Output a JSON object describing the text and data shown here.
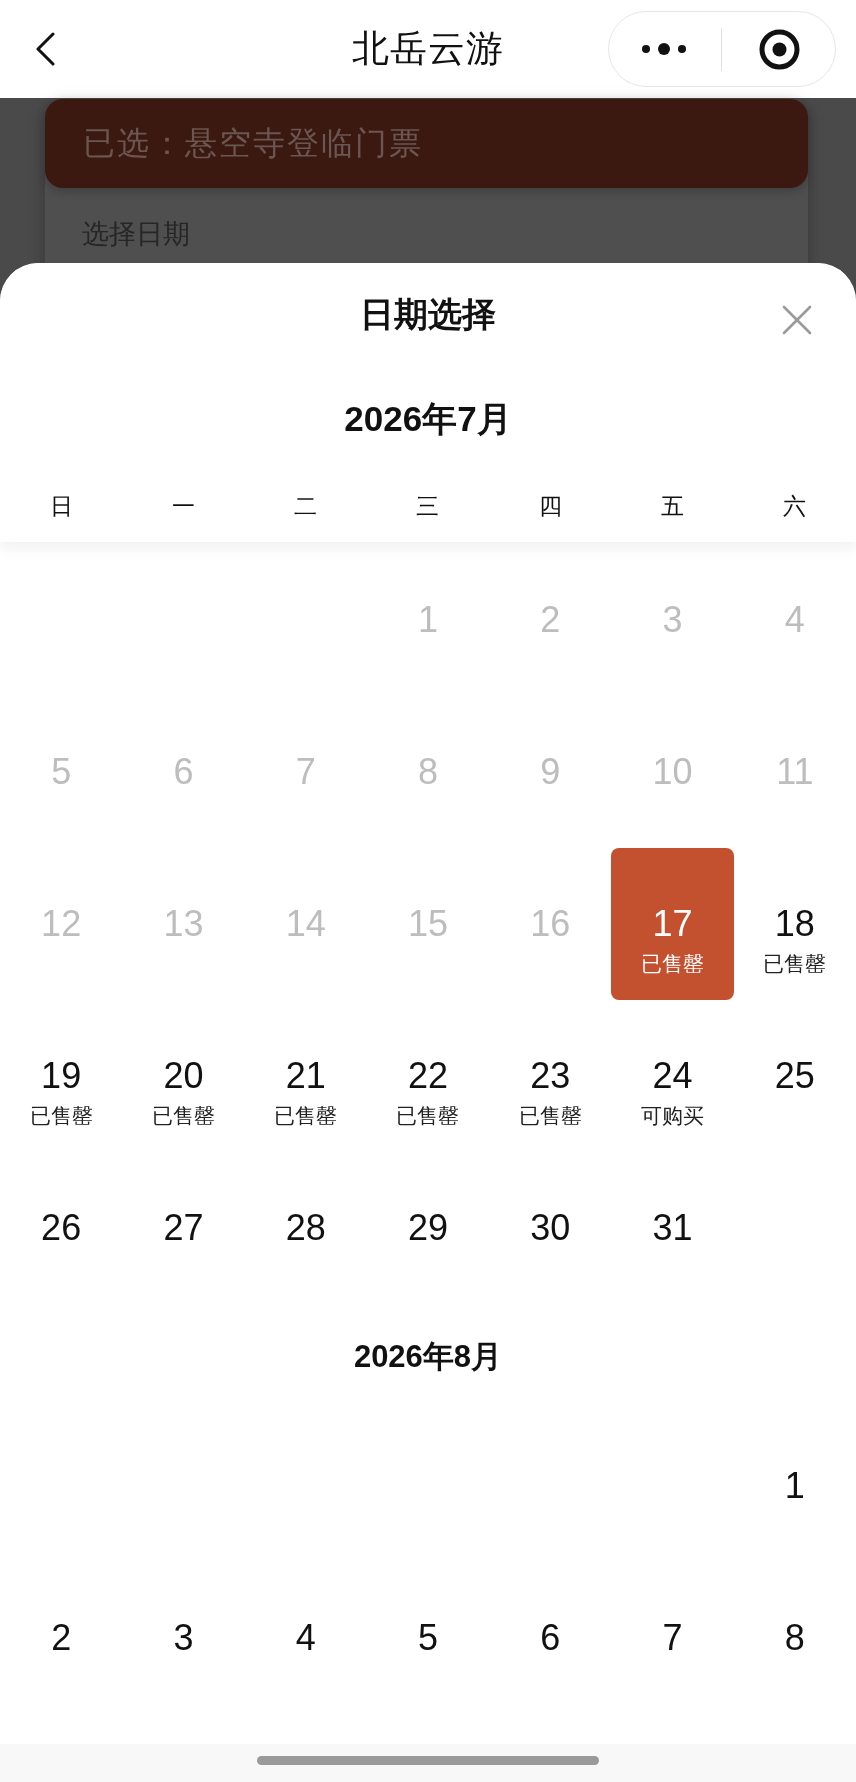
{
  "nav_bar": {
    "title": "北岳云游"
  },
  "background_page": {
    "selected_banner": "已选：悬空寺登临门票",
    "section_label": "选择日期"
  },
  "date_sheet": {
    "title": "日期选择",
    "current_month": "2026年7月",
    "weekdays": [
      "日",
      "一",
      "二",
      "三",
      "四",
      "五",
      "六"
    ],
    "months": [
      {
        "weeks": [
          {
            "right_aligned": true,
            "days": [
              {
                "day": "1",
                "disabled": true,
                "selected": false
              },
              {
                "day": "2",
                "disabled": true,
                "selected": false
              },
              {
                "day": "3",
                "disabled": true,
                "selected": false
              },
              {
                "day": "4",
                "disabled": true,
                "selected": false
              }
            ]
          },
          {
            "days": [
              {
                "day": "5",
                "disabled": true,
                "selected": false
              },
              {
                "day": "6",
                "disabled": true,
                "selected": false
              },
              {
                "day": "7",
                "disabled": true,
                "selected": false
              },
              {
                "day": "8",
                "disabled": true,
                "selected": false
              },
              {
                "day": "9",
                "disabled": true,
                "selected": false
              },
              {
                "day": "10",
                "disabled": true,
                "selected": false
              },
              {
                "day": "11",
                "disabled": true,
                "selected": false
              }
            ]
          },
          {
            "days": [
              {
                "day": "12",
                "disabled": true,
                "selected": false
              },
              {
                "day": "13",
                "disabled": true,
                "selected": false
              },
              {
                "day": "14",
                "disabled": true,
                "selected": false
              },
              {
                "day": "15",
                "disabled": true,
                "selected": false
              },
              {
                "day": "16",
                "disabled": true,
                "selected": false
              },
              {
                "day": "17",
                "disabled": false,
                "selected": true,
                "status": "已售罄"
              },
              {
                "day": "18",
                "disabled": false,
                "selected": false,
                "status": "已售罄"
              }
            ]
          },
          {
            "days": [
              {
                "day": "19",
                "disabled": false,
                "selected": false,
                "status": "已售罄"
              },
              {
                "day": "20",
                "disabled": false,
                "selected": false,
                "status": "已售罄"
              },
              {
                "day": "21",
                "disabled": false,
                "selected": false,
                "status": "已售罄"
              },
              {
                "day": "22",
                "disabled": false,
                "selected": false,
                "status": "已售罄"
              },
              {
                "day": "23",
                "disabled": false,
                "selected": false,
                "status": "已售罄"
              },
              {
                "day": "24",
                "disabled": false,
                "selected": false,
                "status": "可购买"
              },
              {
                "day": "25",
                "disabled": false,
                "selected": false
              }
            ]
          },
          {
            "right_aligned": false,
            "days": [
              {
                "day": "26",
                "disabled": false,
                "selected": false
              },
              {
                "day": "27",
                "disabled": false,
                "selected": false
              },
              {
                "day": "28",
                "disabled": false,
                "selected": false
              },
              {
                "day": "29",
                "disabled": false,
                "selected": false
              },
              {
                "day": "30",
                "disabled": false,
                "selected": false
              },
              {
                "day": "31",
                "disabled": false,
                "selected": false
              }
            ]
          }
        ]
      },
      {
        "title": "2026年8月",
        "weeks": [
          {
            "right_aligned": true,
            "days": [
              {
                "day": "1",
                "disabled": false,
                "selected": false
              }
            ]
          },
          {
            "days": [
              {
                "day": "2",
                "disabled": false,
                "selected": false
              },
              {
                "day": "3",
                "disabled": false,
                "selected": false
              },
              {
                "day": "4",
                "disabled": false,
                "selected": false
              },
              {
                "day": "5",
                "disabled": false,
                "selected": false
              },
              {
                "day": "6",
                "disabled": false,
                "selected": false
              },
              {
                "day": "7",
                "disabled": false,
                "selected": false
              },
              {
                "day": "8",
                "disabled": false,
                "selected": false
              }
            ]
          }
        ]
      }
    ]
  }
}
